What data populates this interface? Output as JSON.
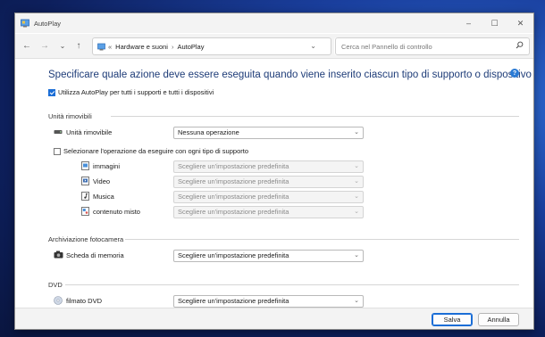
{
  "window": {
    "title": "AutoPlay",
    "controls": {
      "minimize": "–",
      "maximize": "☐",
      "close": "✕"
    }
  },
  "nav": {
    "back": "←",
    "forward": "→",
    "recent": "⌄",
    "up": "↑",
    "breadcrumb": [
      "Hardware e suoni",
      "AutoPlay"
    ],
    "crumb_prefix": "«",
    "separator": "›",
    "search_placeholder": "Cerca nel Pannello di controllo"
  },
  "main": {
    "heading": "Specificare quale azione deve essere eseguita quando viene inserito ciascun tipo di supporto o dispositivo",
    "help": "?",
    "use_autoplay": {
      "label": "Utilizza AutoPlay per tutti i supporti e tutti i dispositivi",
      "checked": true
    }
  },
  "removable": {
    "title": "Unità rimovibili",
    "drive_label": "Unità rimovibile",
    "drive_value": "Nessuna operazione",
    "per_media": {
      "label": "Selezionare l'operazione da eseguire con ogni tipo di supporto",
      "checked": false
    },
    "media": [
      {
        "label": "immagini",
        "value": "Scegliere un'impostazione predefinita",
        "icon": "pictures-icon"
      },
      {
        "label": "Video",
        "value": "Scegliere un'impostazione predefinita",
        "icon": "video-icon"
      },
      {
        "label": "Musica",
        "value": "Scegliere un'impostazione predefinita",
        "icon": "music-icon"
      },
      {
        "label": "contenuto misto",
        "value": "Scegliere un'impostazione predefinita",
        "icon": "mixed-content-icon"
      }
    ]
  },
  "camera": {
    "title": "Archiviazione fotocamera",
    "item_label": "Scheda di memoria",
    "item_value": "Scegliere un'impostazione predefinita"
  },
  "dvd": {
    "title": "DVD",
    "item_label": "filmato DVD",
    "item_value": "Scegliere un'impostazione predefinita"
  },
  "footer": {
    "save": "Salva",
    "cancel": "Annulla"
  },
  "colors": {
    "accent": "#1a6dd6",
    "heading": "#1e3c78",
    "desktop": "#1a3f9e"
  }
}
